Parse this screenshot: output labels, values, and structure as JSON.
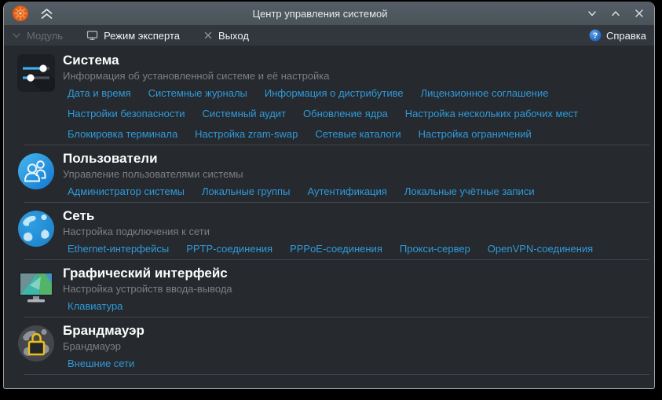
{
  "window": {
    "title": "Центр управления системой"
  },
  "menubar": {
    "module_label": "Модуль",
    "expert_label": "Режим эксперта",
    "exit_label": "Выход",
    "help_label": "Справка"
  },
  "sections": [
    {
      "title": "Система",
      "subtitle": "Информация об установленной системе и её настройка",
      "icon": "sliders-icon",
      "links": [
        "Дата и время",
        "Системные журналы",
        "Информация о дистрибутиве",
        "Лицензионное соглашение",
        "Настройки безопасности",
        "Системный аудит",
        "Обновление ядра",
        "Настройка нескольких рабочих мест",
        "Блокировка терминала",
        "Настройка zram-swap",
        "Сетевые каталоги",
        "Настройка ограничений"
      ]
    },
    {
      "title": "Пользователи",
      "subtitle": "Управление пользователями системы",
      "icon": "users-icon",
      "links": [
        "Администратор системы",
        "Локальные группы",
        "Аутентификация",
        "Локальные учётные записи"
      ]
    },
    {
      "title": "Сеть",
      "subtitle": "Настройка подключения к сети",
      "icon": "globe-icon",
      "links": [
        "Ethernet-интерфейсы",
        "PPTP-соединения",
        "PPPoE-соединения",
        "Прокси-сервер",
        "OpenVPN-соединения"
      ]
    },
    {
      "title": "Графический интерфейс",
      "subtitle": "Настройка устройств ввода-вывода",
      "icon": "monitor-icon",
      "links": [
        "Клавиатура"
      ]
    },
    {
      "title": "Брандмауэр",
      "subtitle": "Брандмауэр",
      "icon": "firewall-lock-icon",
      "links": [
        "Внешние сети"
      ]
    }
  ],
  "colors": {
    "link": "#2f9bdc",
    "titlebar": "#4f585f",
    "menubar": "#31373c",
    "content_bg": "#26292d",
    "accent": "#3daee9",
    "lock_yellow": "#f3c018"
  }
}
